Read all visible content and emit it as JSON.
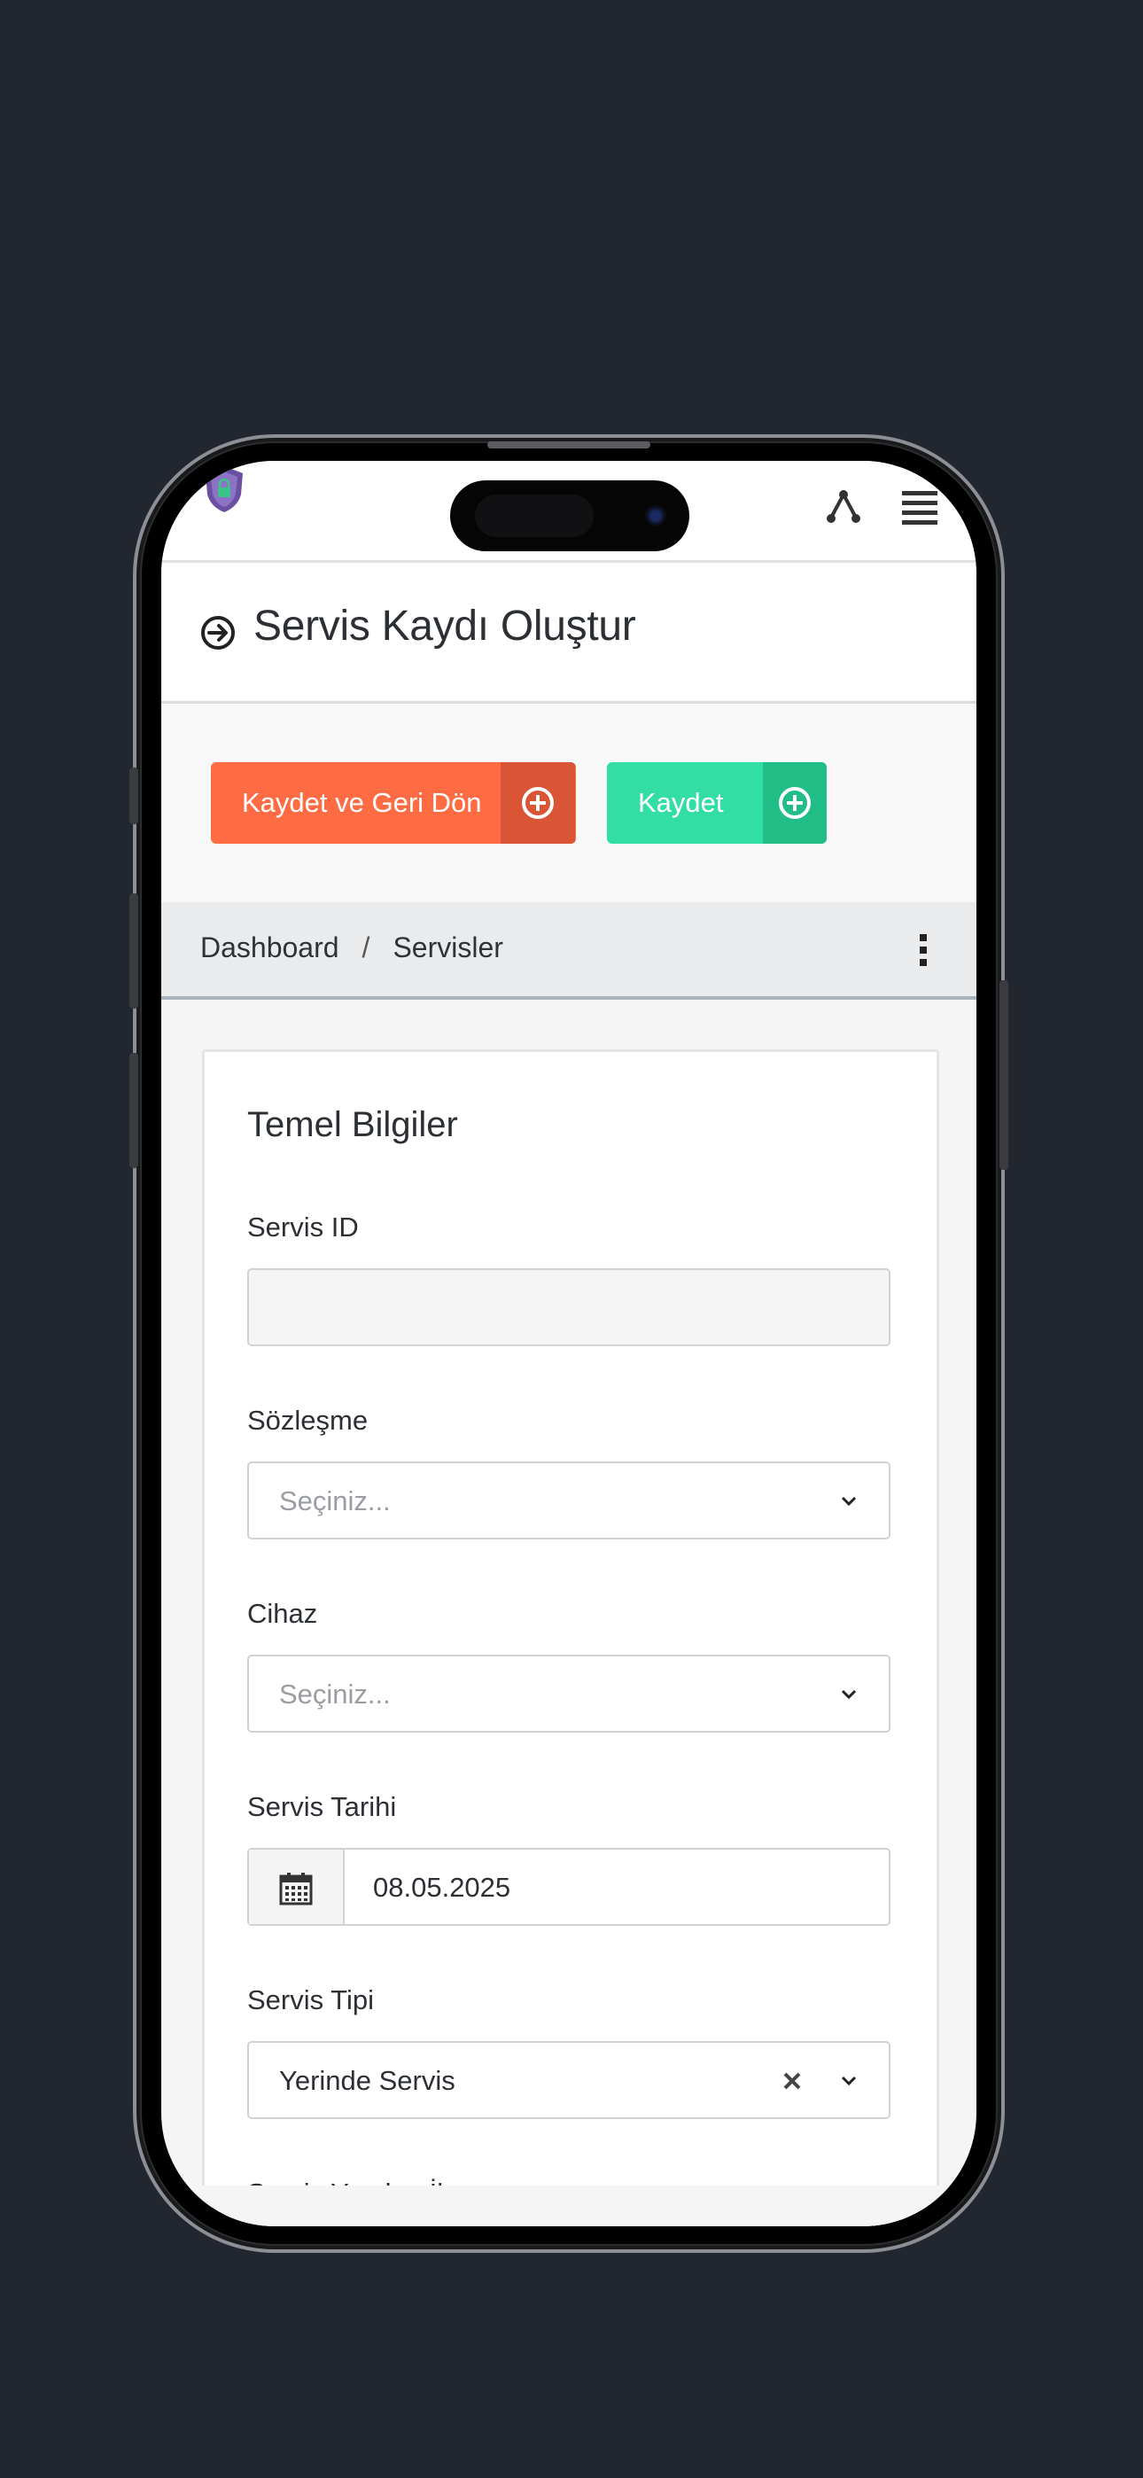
{
  "header": {
    "logo": "shield-logo-icon",
    "network_icon": "network-icon",
    "menu_icon": "hamburger-menu-icon"
  },
  "page": {
    "title": "Servis Kaydı Oluştur",
    "title_icon": "arrow-right-circle-icon"
  },
  "actions": {
    "save_and_back_label": "Kaydet ve Geri Dön",
    "save_label": "Kaydet",
    "orange": "#ff6b42",
    "green": "#33dea4"
  },
  "breadcrumb": {
    "items": [
      "Dashboard",
      "Servisler"
    ],
    "separator": "/"
  },
  "form": {
    "section_title": "Temel Bilgiler",
    "servis_id": {
      "label": "Servis ID",
      "value": ""
    },
    "sozlesme": {
      "label": "Sözleşme",
      "placeholder": "Seçiniz..."
    },
    "cihaz": {
      "label": "Cihaz",
      "placeholder": "Seçiniz..."
    },
    "servis_tarihi": {
      "label": "Servis Tarihi",
      "value": "08.05.2025"
    },
    "servis_tipi": {
      "label": "Servis Tipi",
      "value": "Yerinde Servis"
    },
    "servis_yapilan_il": {
      "label": "Servis Yapılan İl"
    }
  }
}
